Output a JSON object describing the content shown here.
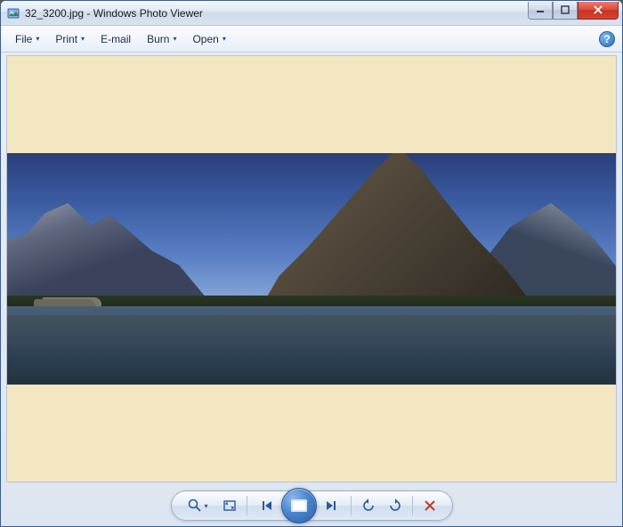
{
  "window": {
    "filename": "32_3200.jpg",
    "app_name": "Windows Photo Viewer",
    "title": "32_3200.jpg - Windows Photo Viewer"
  },
  "window_controls": {
    "minimize": "Minimize",
    "maximize": "Maximize",
    "close": "Close"
  },
  "menubar": {
    "file": "File",
    "print": "Print",
    "email": "E-mail",
    "burn": "Burn",
    "open": "Open",
    "help_tooltip": "Get help"
  },
  "toolbar": {
    "zoom": "Change the display size",
    "fit": "Fit to window",
    "previous": "Previous (Left arrow)",
    "play": "Play slide show (F11)",
    "next": "Next (Right arrow)",
    "rotate_ccw": "Rotate counterclockwise (Ctrl+,)",
    "rotate_cw": "Rotate clockwise (Ctrl+.)",
    "delete": "Delete (Del)"
  },
  "image": {
    "description": "Panoramic landscape photograph of mountains and a lake with reflections, clear blue sky",
    "background_color": "#f3e7c2"
  },
  "icons": {
    "app": "photo-viewer-icon",
    "chevron": "▾",
    "help": "?"
  },
  "colors": {
    "accent": "#2a5fa8",
    "chrome": "#dfe8f4",
    "close": "#d94b3c"
  }
}
